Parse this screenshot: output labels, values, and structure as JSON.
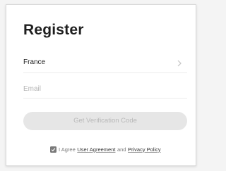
{
  "register": {
    "title": "Register",
    "country": "France",
    "email_placeholder": "Email",
    "email_value": "",
    "verify_button": "Get Verification Code",
    "agree": {
      "checked": true,
      "prefix": "I Agree",
      "user_agreement": "User Agreement",
      "and": "and",
      "privacy_policy": "Privacy Policy"
    }
  },
  "icons": {
    "country_chevron": "chevron-right-icon",
    "agree_check": "checkmark-icon"
  },
  "colors": {
    "title": "#1f1f1f",
    "button_bg": "#e6e6e6",
    "button_text": "#b8b8b8",
    "checkbox": "#7a7a7a"
  }
}
